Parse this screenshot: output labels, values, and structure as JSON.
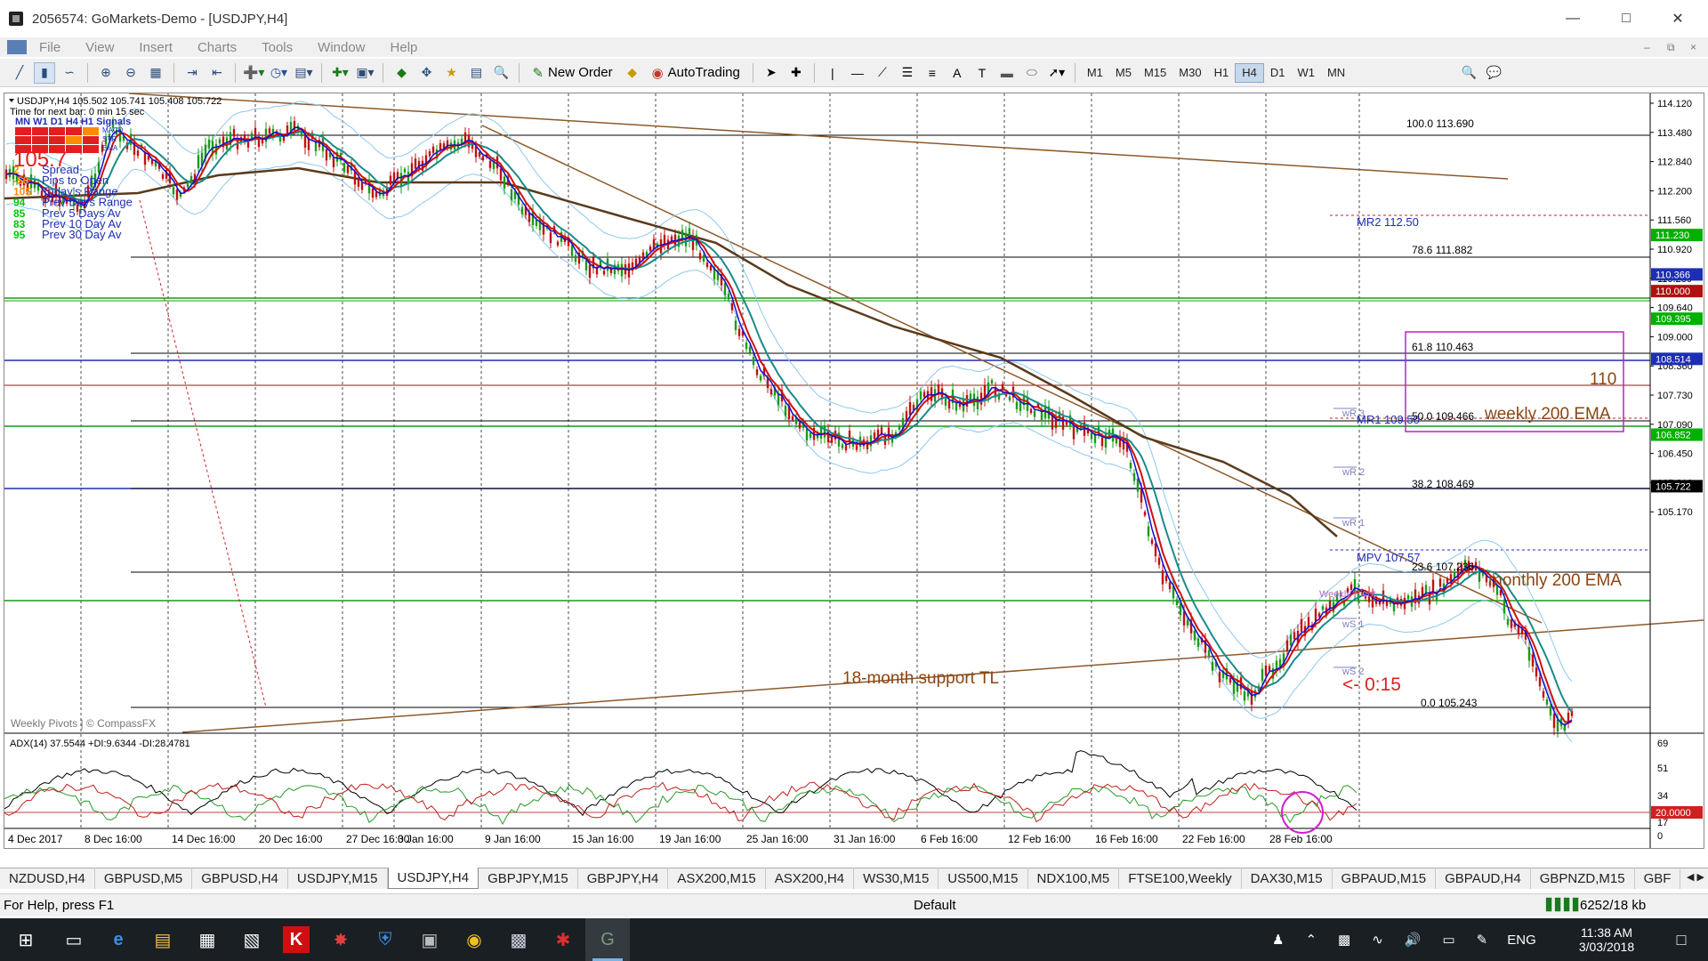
{
  "window": {
    "title": "2056574: GoMarkets-Demo - [USDJPY,H4]"
  },
  "menu": {
    "items": [
      "File",
      "View",
      "Insert",
      "Charts",
      "Tools",
      "Window",
      "Help"
    ]
  },
  "toolbar": {
    "new_order": "New Order",
    "autotrading": "AutoTrading",
    "timeframes": [
      "M1",
      "M5",
      "M15",
      "M30",
      "H1",
      "H4",
      "D1",
      "W1",
      "MN"
    ],
    "active_timeframe": "H4"
  },
  "chart": {
    "header": "USDJPY,H4  105.502 105.741 105.408 105.722",
    "time_next_bar": "Time for next bar: 0 min 15 sec",
    "signals_title": "MN W1 D1  H4  H1  Signals",
    "signals_labels": [
      "MACD",
      "STR",
      "EMA"
    ],
    "big_price": "105.7",
    "info_rows": [
      {
        "value": "2",
        "label": "Spread",
        "color": "#ff8c00"
      },
      {
        "value": "-50",
        "label": "Pips to Open",
        "color": "#ff8c00"
      },
      {
        "value": "105",
        "label": "Today's Range",
        "color": "#ff8c00"
      },
      {
        "value": "94",
        "label": "Prev Days Range",
        "color": "#00c800"
      },
      {
        "value": "85",
        "label": "Prev 5 Days Av",
        "color": "#00c800"
      },
      {
        "value": "83",
        "label": "Prev 10 Day Av",
        "color": "#00c800"
      },
      {
        "value": "95",
        "label": "Prev 30 Day Av",
        "color": "#00c800"
      }
    ],
    "price_axis": [
      "114.120",
      "113.480",
      "112.840",
      "112.200",
      "111.560",
      "110.920",
      "110.280",
      "109.640",
      "109.000",
      "108.360",
      "107.730",
      "107.090",
      "106.450",
      "105.810",
      "105.170"
    ],
    "price_tags": [
      {
        "price": "111.230",
        "color": "#00b000"
      },
      {
        "price": "110.366",
        "color": "#1e2eb4"
      },
      {
        "price": "110.000",
        "color": "#b01010"
      },
      {
        "price": "109.395",
        "color": "#00b000"
      },
      {
        "price": "108.514",
        "color": "#1e2eb4"
      },
      {
        "price": "106.852",
        "color": "#00b000"
      },
      {
        "price": "105.722",
        "color": "#000000"
      }
    ],
    "fib_labels": [
      "100.0  113.690",
      "78.6  111.882",
      "61.8  110.463",
      "50.0  109.466",
      "38.2  108.469",
      "23.6  107.236",
      "0.0  105.243"
    ],
    "pivot_labels": [
      "MR2   112.50",
      "MR1   109.50",
      "MPV   107.57"
    ],
    "weekly_labels": [
      "wR 3",
      "wR 2",
      "wR 1",
      "Weekly Pivot",
      "wS 1",
      "wS 2"
    ],
    "annotations": {
      "round_number": "110",
      "weekly_ema": "weekly 200 EMA",
      "monthly_ema": "monthly 200 EMA",
      "support_tl": "18-month support TL",
      "countdown": "<- 0:15",
      "source": "Weekly Pivots | © CompassFX"
    },
    "time_axis": [
      "4 Dec 2017",
      "8 Dec 16:00",
      "14 Dec 16:00",
      "20 Dec 16:00",
      "27 Dec 16:00",
      "3 Jan 16:00",
      "9 Jan 16:00",
      "15 Jan 16:00",
      "19 Jan 16:00",
      "25 Jan 16:00",
      "31 Jan 16:00",
      "6 Feb 16:00",
      "12 Feb 16:00",
      "16 Feb 16:00",
      "22 Feb 16:00",
      "28 Feb 16:00"
    ],
    "adx_header": "ADX(14) 37.5544 +DI:9.6344 -DI:28.4781",
    "adx_axis": [
      "69",
      "51",
      "34",
      "17",
      "0"
    ],
    "adx_level": "20.0000"
  },
  "tabs": [
    "NZDUSD,H4",
    "GBPUSD,M5",
    "GBPUSD,H4",
    "USDJPY,M15",
    "USDJPY,H4",
    "GBPJPY,M15",
    "GBPJPY,H4",
    "ASX200,M15",
    "ASX200,H4",
    "WS30,M15",
    "US500,M15",
    "NDX100,M5",
    "FTSE100,Weekly",
    "DAX30,M15",
    "GBPAUD,M15",
    "GBPAUD,H4",
    "GBPNZD,M15",
    "GBF"
  ],
  "active_tab": "USDJPY,H4",
  "status": {
    "help": "For Help, press F1",
    "profile": "Default",
    "traffic": "6252/18 kb"
  },
  "taskbar": {
    "language": "ENG",
    "time": "11:38 AM",
    "date": "3/03/2018"
  }
}
